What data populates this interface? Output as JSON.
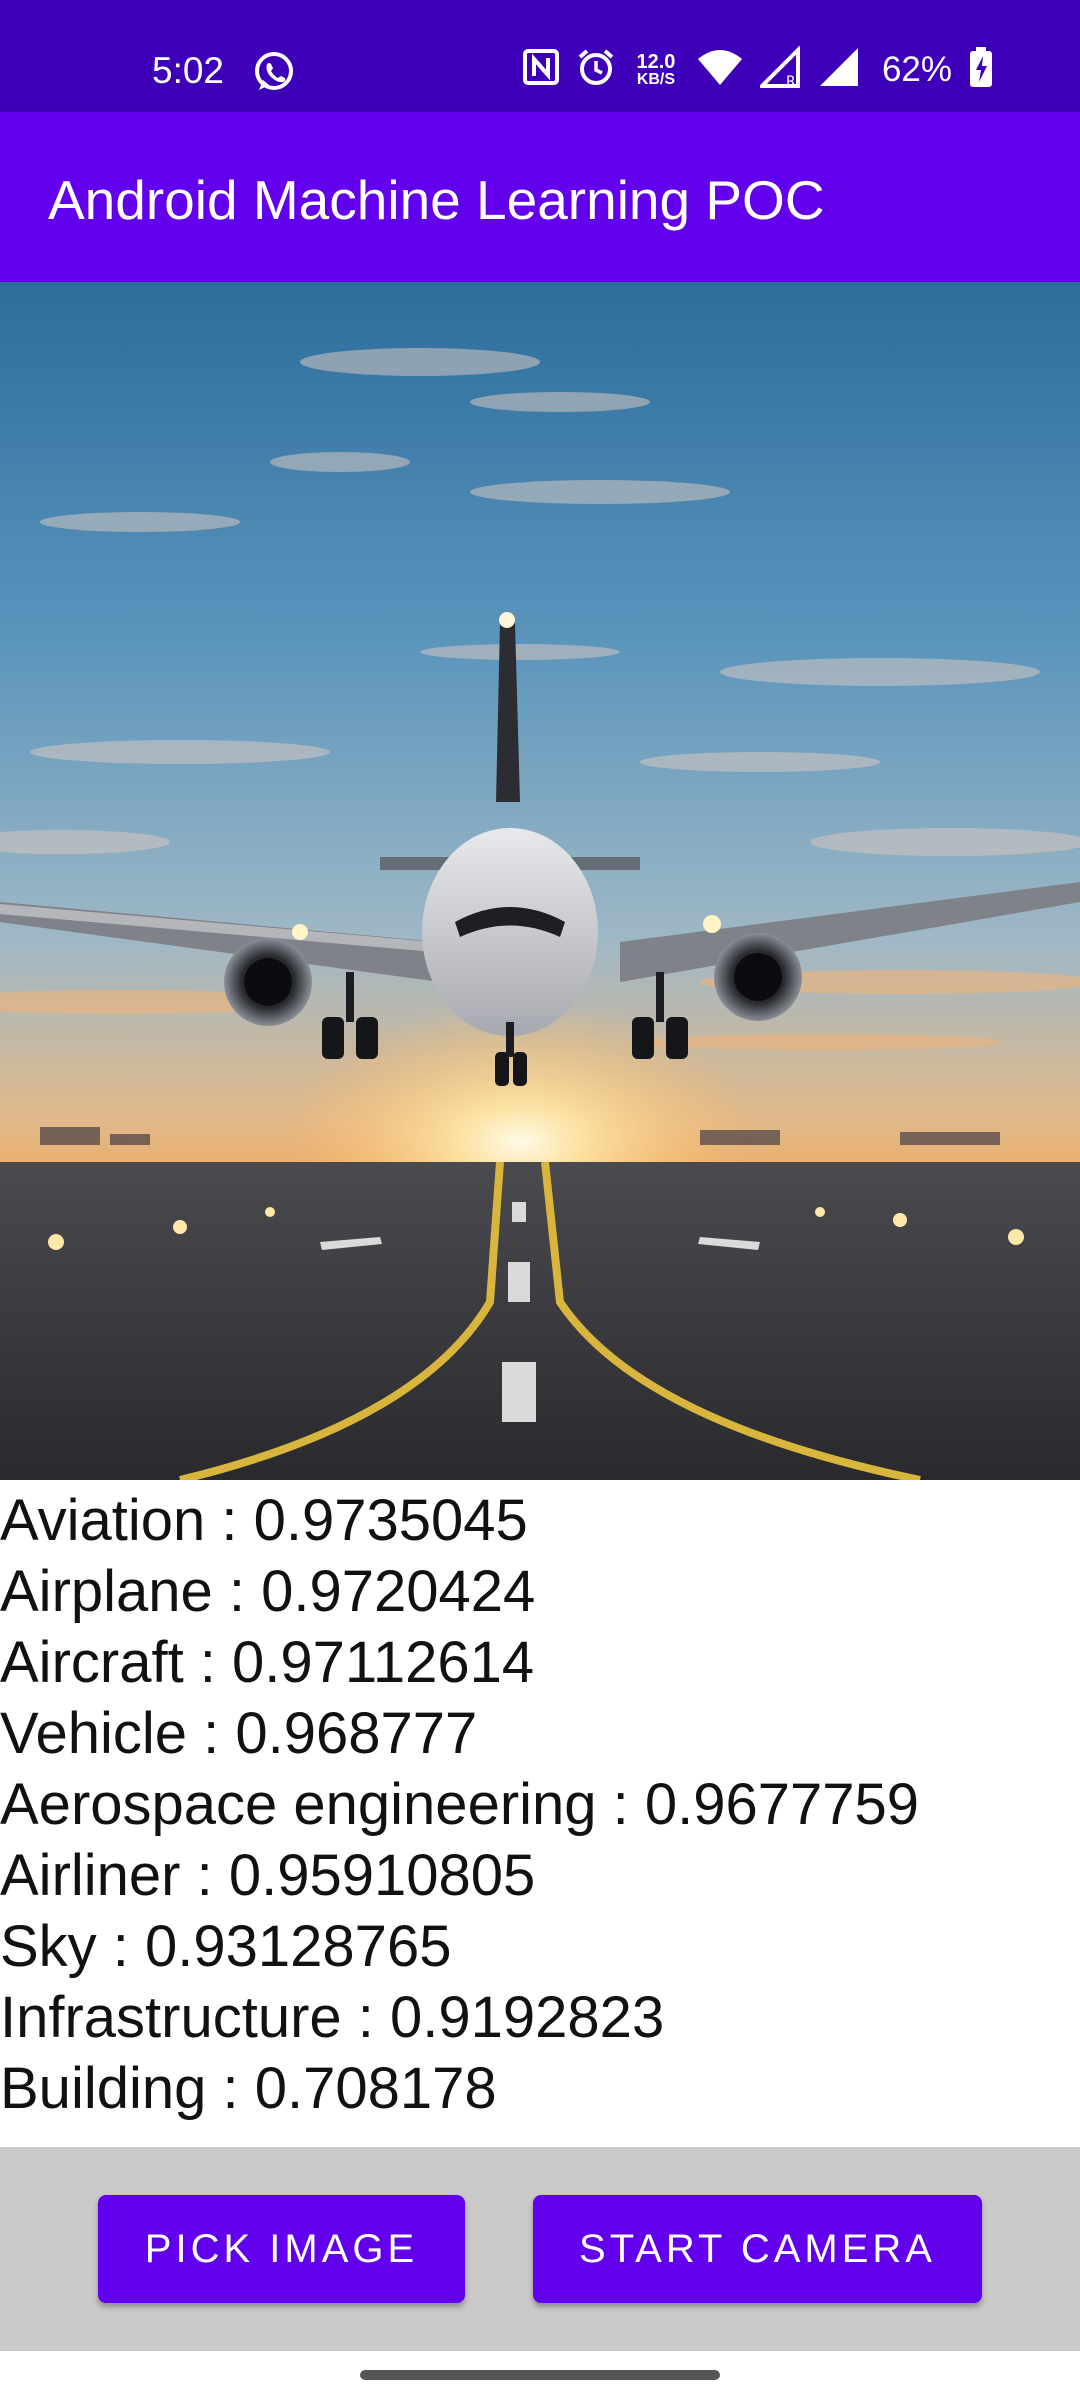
{
  "status_bar": {
    "time": "5:02",
    "netspeed_value": "12.0",
    "netspeed_unit": "KB/S",
    "battery": "62%",
    "icons": [
      "whatsapp-icon",
      "nfc-icon",
      "alarm-icon",
      "wifi-icon",
      "signal-r-icon",
      "signal-icon",
      "battery-charging-icon"
    ]
  },
  "app_bar": {
    "title": "Android Machine Learning POC",
    "color": "#6200ee"
  },
  "image": {
    "subject": "airplane-landing-photo"
  },
  "labels": [
    "Aviation : 0.9735045",
    "Airplane : 0.9720424",
    "Aircraft : 0.97112614",
    "Vehicle : 0.968777",
    "Aerospace engineering : 0.9677759",
    "Airliner : 0.95910805",
    "Sky : 0.93128765",
    "Infrastructure : 0.9192823",
    "Building : 0.708178"
  ],
  "buttons": {
    "pick_image": "PICK IMAGE",
    "start_camera": "START CAMERA"
  },
  "colors": {
    "status_bar": "#3d00b8",
    "accent": "#6200ee",
    "bottom_panel": "#cccac8"
  }
}
